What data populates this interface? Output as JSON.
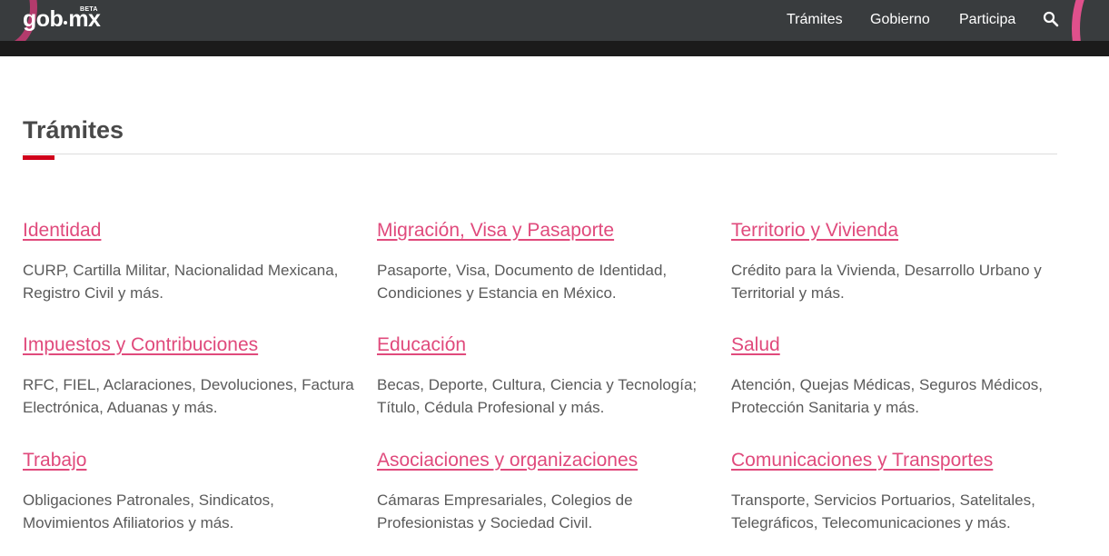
{
  "header": {
    "logo_text_left": "gob",
    "logo_text_right": "mx",
    "beta_badge": "BETA",
    "nav": [
      {
        "label": "Trámites"
      },
      {
        "label": "Gobierno"
      },
      {
        "label": "Participa"
      }
    ],
    "search_icon": "search-icon"
  },
  "main": {
    "title": "Trámites",
    "cards": [
      {
        "title": "Identidad",
        "description": "CURP, Cartilla Militar, Nacionalidad Mexicana, Registro Civil y más."
      },
      {
        "title": "Migración, Visa y Pasaporte",
        "description": "Pasaporte, Visa, Documento de Identidad, Condiciones y Estancia en México."
      },
      {
        "title": "Territorio y Vivienda",
        "description": "Crédito para la Vivienda, Desarrollo Urbano y Territorial y más."
      },
      {
        "title": "Impuestos y Contribuciones",
        "description": "RFC, FIEL, Aclaraciones, Devoluciones, Factura Electrónica, Aduanas y más."
      },
      {
        "title": "Educación",
        "description": "Becas, Deporte, Cultura, Ciencia y Tecnología; Título, Cédula Profesional y más."
      },
      {
        "title": "Salud",
        "description": "Atención, Quejas Médicas, Seguros Médicos, Protección Sanitaria y más."
      },
      {
        "title": "Trabajo",
        "description": "Obligaciones Patronales, Sindicatos, Movimientos Afiliatorios y más."
      },
      {
        "title": "Asociaciones y organizaciones",
        "description": "Cámaras Empresariales, Colegios de Profesionistas y Sociedad Civil."
      },
      {
        "title": "Comunicaciones y Transportes",
        "description": "Transporte, Servicios Portuarios, Satelitales, Telegráficos, Telecomunicaciones y más."
      }
    ]
  },
  "colors": {
    "header_bg": "#393c3e",
    "link": "#e04a7c",
    "accent": "#d0021b",
    "title": "#494949",
    "text": "#5a5a5a"
  }
}
